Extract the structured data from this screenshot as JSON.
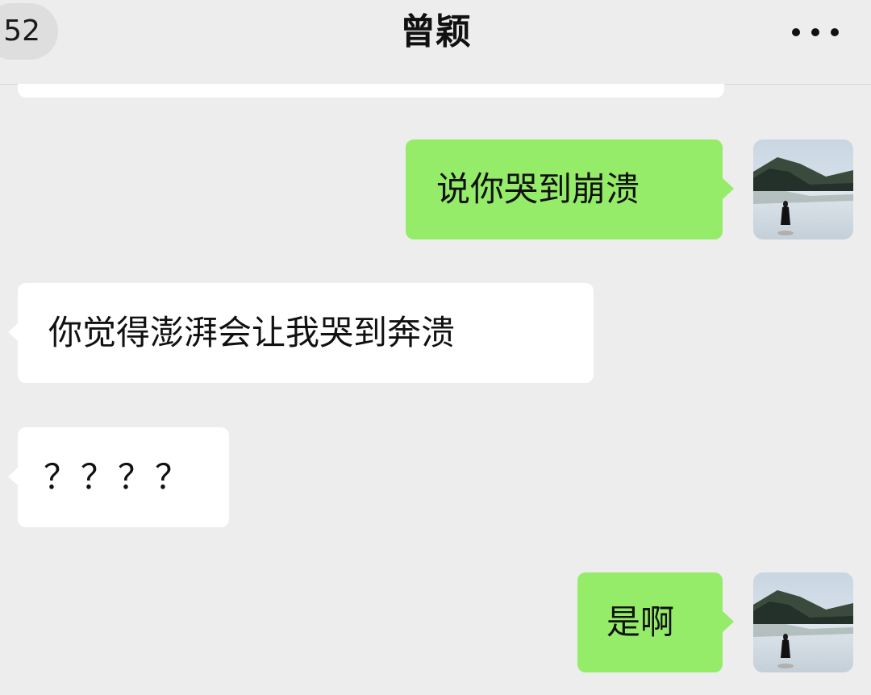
{
  "header": {
    "back_count": "52",
    "title": "曾颖",
    "more_icon": "more-dots-icon"
  },
  "messages": [
    {
      "direction": "outgoing",
      "text": "说你哭到崩溃"
    },
    {
      "direction": "incoming",
      "text": "你觉得澎湃会让我哭到奔溃"
    },
    {
      "direction": "incoming",
      "text": "？？？？"
    },
    {
      "direction": "outgoing",
      "text": "是啊"
    }
  ],
  "colors": {
    "background": "#ededed",
    "outgoing_bubble": "#95ec69",
    "incoming_bubble": "#ffffff"
  },
  "avatar_icon": "landscape-avatar"
}
